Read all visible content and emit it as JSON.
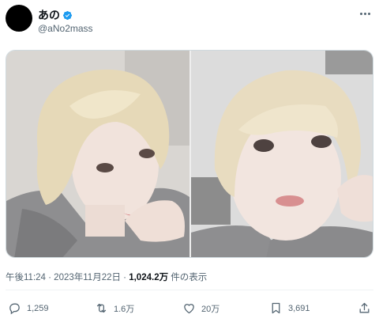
{
  "author": {
    "display_name": "あの",
    "handle": "@aNo2mass",
    "verified": true
  },
  "icons": {
    "more": "more-dots-icon",
    "verified": "verified-badge-icon",
    "reply": "reply-icon",
    "retweet": "retweet-icon",
    "like": "heart-icon",
    "bookmark": "bookmark-icon",
    "share": "share-icon"
  },
  "media": [
    {
      "alt": "photo-1"
    },
    {
      "alt": "photo-2"
    }
  ],
  "meta": {
    "time": "午後11:24",
    "separator": " · ",
    "date": "2023年11月22日",
    "separator2": " · ",
    "views_count": "1,024.2万",
    "views_label": " 件の表示"
  },
  "actions": {
    "replies": "1,259",
    "reposts": "1.6万",
    "likes": "20万",
    "bookmarks": "3,691"
  },
  "colors": {
    "verified_blue": "#1d9bf0",
    "secondary_text": "#536471",
    "primary_text": "#0f1419"
  }
}
